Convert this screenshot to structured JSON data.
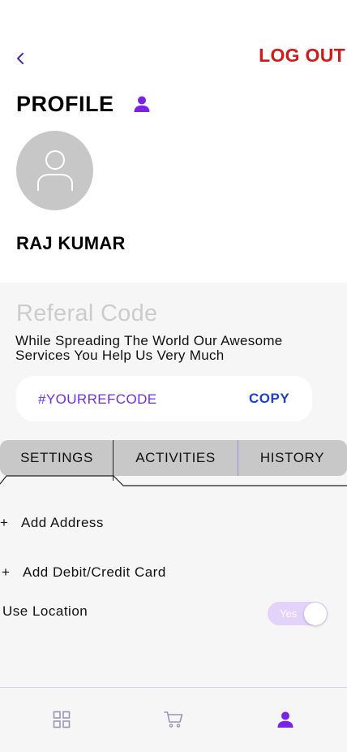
{
  "header": {
    "back_icon": "chevron-left-icon",
    "logout_label": "LOG OUT"
  },
  "profile": {
    "title": "PROFILE",
    "title_icon": "user-icon",
    "avatar_icon": "user-outline-icon",
    "name": "RAJ KUMAR"
  },
  "referral": {
    "title": "Referal Code",
    "description": "While Spreading The World Our Awesome Services You Help Us Very Much",
    "code": "#YOURREFCODE",
    "copy_label": "COPY"
  },
  "tabs": [
    {
      "label": "SETTINGS",
      "active": true
    },
    {
      "label": "ACTIVITIES",
      "active": false
    },
    {
      "label": "HISTORY",
      "active": false
    }
  ],
  "settings": {
    "add_address_label": "Add Address",
    "add_card_label": "Add Debit/Credit Card",
    "plus_symbol": "+",
    "use_location_label": "Use Location",
    "use_location_toggle_text": "Yes",
    "use_location_enabled": true
  },
  "bottom_nav": {
    "items": [
      {
        "icon": "grid-icon",
        "active": false
      },
      {
        "icon": "cart-icon",
        "active": false
      },
      {
        "icon": "user-icon",
        "active": true
      }
    ]
  },
  "colors": {
    "logout": "#d11a1a",
    "accent_purple": "#7a22e6",
    "ref_code": "#6d2ee0",
    "copy": "#1f3fc9",
    "toggle_track": "#e3d3fb",
    "inactive_icon": "#9b94b8"
  }
}
